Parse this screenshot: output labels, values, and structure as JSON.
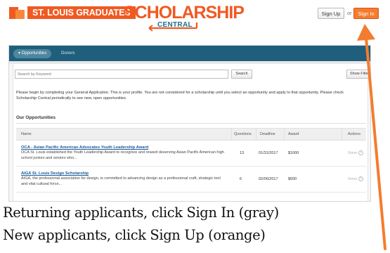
{
  "header": {
    "brand": "ST. LOUIS GRADUATES",
    "logo_main": "SCHOLARSHIP",
    "logo_sub": "CENTRAL",
    "signup_label": "Sign Up",
    "or_label": "or",
    "signin_label": "Sign In"
  },
  "nav": {
    "tabs": [
      {
        "label": "▾ Opportunities"
      },
      {
        "label": "Donors"
      }
    ]
  },
  "search": {
    "placeholder": "Search by Keyword",
    "button_label": "Search",
    "filters_label": "Show Filters"
  },
  "intro_text": "Please begin by completing your General Application. This is your profile. You are not considered for a scholarship until you select an opportunity and apply to that opportunity. Please check Scholarship Central periodically to see new, open opportunities.",
  "section_title": "Our Opportunities",
  "table": {
    "columns": [
      "Name",
      "Questions",
      "Deadline",
      "Award",
      "Actions"
    ],
    "rows": [
      {
        "title": "OCA - Asian Pacific American Advocates Youth Leadership Award",
        "desc": "OCA St. Louis established the Youth Leadership Award to recognize and reward deserving Asian Pacific American high school juniors and seniors who...",
        "questions": "13",
        "deadline": "01/31/2017",
        "award": "$1000",
        "action": "None"
      },
      {
        "title": "AIGA St. Louis Design Scholarship",
        "desc": "AIGA, the professional association for design, is committed to advancing design as a professional craft, strategic tool and vital cultural force...",
        "questions": "6",
        "deadline": "02/06/2017",
        "award": "$500",
        "action": "None"
      }
    ]
  },
  "captions": {
    "line1": "Returning applicants, click Sign In (gray)",
    "line2": "New applicants, click Sign Up (orange)"
  },
  "colors": {
    "brand_orange": "#f05a22",
    "nav_blue": "#1f5f7c",
    "arrow_orange": "#f47c30"
  }
}
